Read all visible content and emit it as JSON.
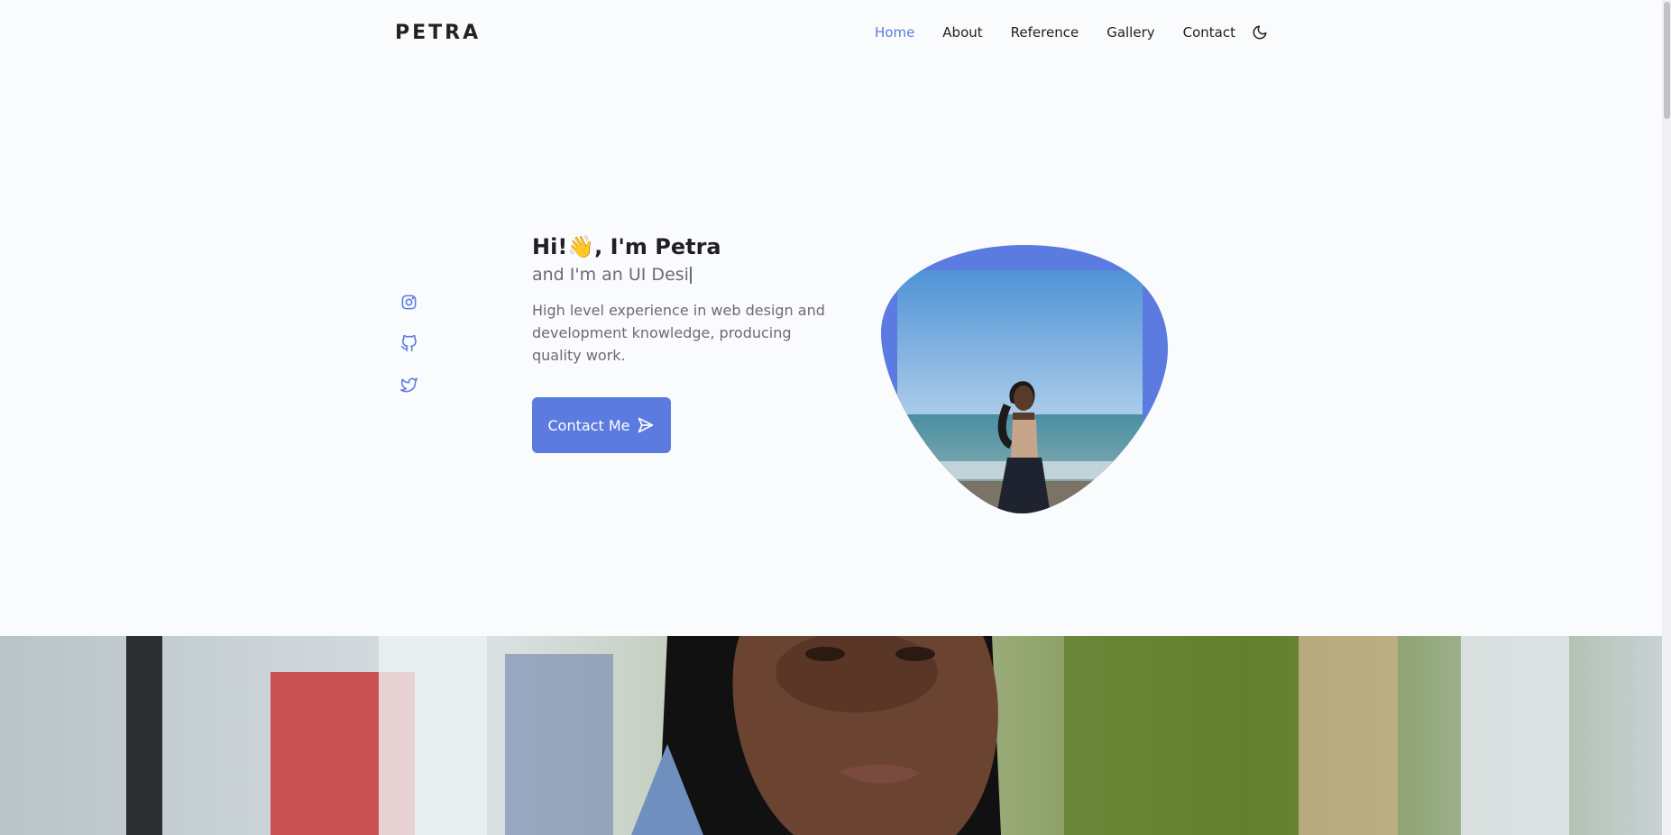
{
  "header": {
    "logo": "PETRA",
    "nav": [
      {
        "label": "Home",
        "active": true
      },
      {
        "label": "About",
        "active": false
      },
      {
        "label": "Reference",
        "active": false
      },
      {
        "label": "Gallery",
        "active": false
      },
      {
        "label": "Contact",
        "active": false
      }
    ],
    "theme_icon": "moon-icon"
  },
  "socials": [
    "instagram-icon",
    "github-icon",
    "twitter-icon"
  ],
  "hero": {
    "title": "Hi!👋, I'm Petra",
    "subtitle": "and I'm an UI Desi",
    "description": "High level experience in web design and development knowledge, producing quality work.",
    "cta_label": "Contact Me",
    "cta_icon": "send-icon"
  },
  "colors": {
    "accent": "#5b7be0",
    "text": "#1f1f24",
    "muted": "#6b6b72",
    "background": "#fafbfd"
  }
}
